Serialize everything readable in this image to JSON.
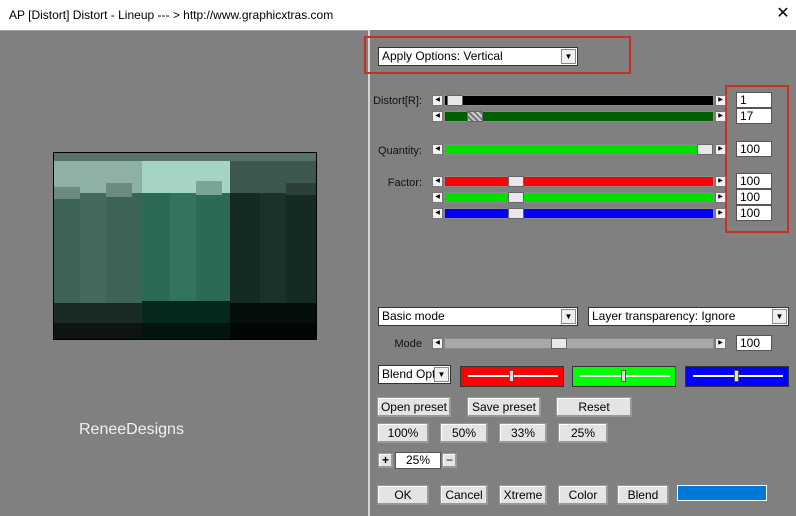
{
  "window": {
    "title": "AP [Distort]  Distort - Lineup    --- > http://www.graphicxtras.com",
    "close_glyph": "✕"
  },
  "watermark": "ReneeDesigns",
  "apply_options": {
    "value": "Apply Options: Vertical"
  },
  "labels": {
    "distort": "Distort[R]:",
    "quantity": "Quantity:",
    "factor": "Factor:",
    "mode": "Mode"
  },
  "values": {
    "distort_1": "1",
    "distort_2": "17",
    "quantity": "100",
    "factor_r": "100",
    "factor_g": "100",
    "factor_b": "100",
    "mode": "100"
  },
  "selects": {
    "mode_select": "Basic mode",
    "layer_transparency": "Layer transparency: Ignore",
    "blend_options": "Blend Optio"
  },
  "buttons": {
    "open_preset": "Open preset",
    "save_preset": "Save preset",
    "reset": "Reset",
    "zoom_100": "100%",
    "zoom_50": "50%",
    "zoom_33": "33%",
    "zoom_25": "25%",
    "zoom_plus": "+",
    "zoom_minus": "−",
    "ok": "OK",
    "cancel": "Cancel",
    "xtreme": "Xtreme",
    "color": "Color",
    "blend": "Blend"
  },
  "zoom_value": "25%",
  "colors": {
    "panel_bg": "#808080",
    "red": "#ff0000",
    "green": "#00e000",
    "blue": "#0000ff",
    "dark_green": "#006000",
    "black": "#000000",
    "blend_color": "#0078d7",
    "highlight_box": "#c8301f"
  }
}
